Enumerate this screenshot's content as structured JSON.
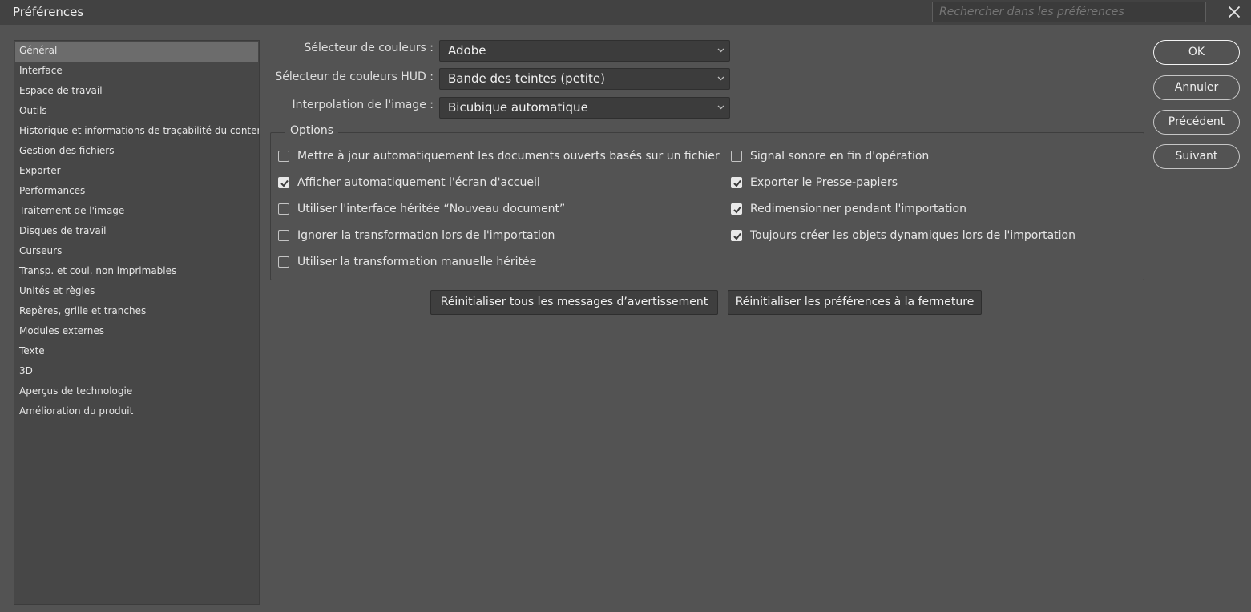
{
  "window": {
    "title": "Préférences",
    "search_placeholder": "Rechercher dans les préférences",
    "close_icon": "close-icon"
  },
  "sidebar": {
    "items": [
      {
        "label": "Général",
        "selected": true
      },
      {
        "label": "Interface"
      },
      {
        "label": "Espace de travail"
      },
      {
        "label": "Outils"
      },
      {
        "label": "Historique et informations de traçabilité du contenu"
      },
      {
        "label": "Gestion des fichiers"
      },
      {
        "label": "Exporter"
      },
      {
        "label": "Performances"
      },
      {
        "label": "Traitement de l'image"
      },
      {
        "label": "Disques de travail"
      },
      {
        "label": "Curseurs"
      },
      {
        "label": "Transp. et coul. non imprimables"
      },
      {
        "label": "Unités et règles"
      },
      {
        "label": "Repères, grille et tranches"
      },
      {
        "label": "Modules externes"
      },
      {
        "label": "Texte"
      },
      {
        "label": "3D"
      },
      {
        "label": "Aperçus de technologie"
      },
      {
        "label": "Amélioration du produit"
      }
    ]
  },
  "general": {
    "color_picker": {
      "label": "Sélecteur de couleurs :",
      "value": "Adobe"
    },
    "hud_color_picker": {
      "label": "Sélecteur de couleurs HUD :",
      "value": "Bande des teintes (petite)"
    },
    "image_interpolation": {
      "label": "Interpolation de l'image :",
      "value": "Bicubique automatique"
    },
    "options_title": "Options",
    "options_left": [
      {
        "label": "Mettre à jour automatiquement les documents ouverts basés sur un fichier",
        "checked": false
      },
      {
        "label": "Afficher automatiquement l'écran d'accueil",
        "checked": true
      },
      {
        "label": "Utiliser l'interface héritée “Nouveau document”",
        "checked": false
      },
      {
        "label": "Ignorer la transformation lors de l'importation",
        "checked": false
      },
      {
        "label": "Utiliser la transformation manuelle héritée",
        "checked": false
      }
    ],
    "options_right": [
      {
        "label": "Signal sonore en fin d'opération",
        "checked": false
      },
      {
        "label": "Exporter le Presse-papiers",
        "checked": true
      },
      {
        "label": "Redimensionner pendant l'importation",
        "checked": true
      },
      {
        "label": "Toujours créer les objets dynamiques lors de l'importation",
        "checked": true
      }
    ],
    "reset_warnings_label": "Réinitialiser tous les messages d’avertissement",
    "reset_prefs_label": "Réinitialiser les préférences à la fermeture"
  },
  "buttons": {
    "ok": "OK",
    "cancel": "Annuler",
    "previous": "Précédent",
    "next": "Suivant"
  },
  "colors": {
    "dialog_bg": "#535353",
    "titlebar_bg": "#424242",
    "selected_item_bg": "#6c6c6c"
  }
}
